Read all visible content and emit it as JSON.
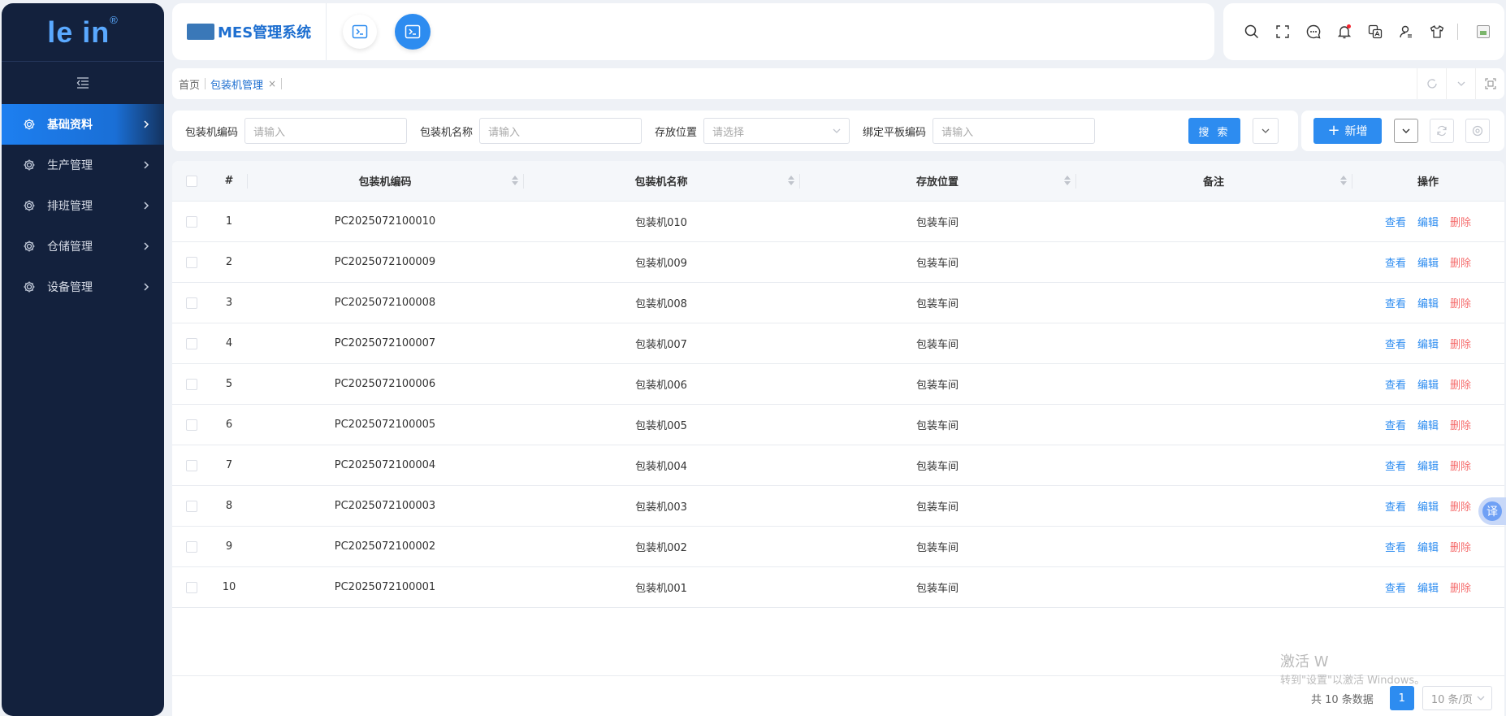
{
  "app": {
    "logo_text": "le  in",
    "logo_mark": "®",
    "system_name": "MES管理系统"
  },
  "sidebar": {
    "items": [
      {
        "label": "基础资料",
        "icon": "gear-icon",
        "active": true
      },
      {
        "label": "生产管理",
        "icon": "gear-icon",
        "active": false
      },
      {
        "label": "排班管理",
        "icon": "gear-icon",
        "active": false
      },
      {
        "label": "仓储管理",
        "icon": "gear-icon",
        "active": false
      },
      {
        "label": "设备管理",
        "icon": "gear-icon",
        "active": false
      }
    ]
  },
  "header": {
    "tools": [
      "search-icon",
      "fullscreen-icon",
      "chat-icon",
      "bell-icon",
      "translate-icon",
      "user-icon",
      "shirt-icon",
      "image-icon"
    ]
  },
  "breadcrumb": {
    "home": "首页",
    "active": "包装机管理",
    "close": "×"
  },
  "filters": {
    "code_label": "包装机编码",
    "code_placeholder": "请输入",
    "name_label": "包装机名称",
    "name_placeholder": "请输入",
    "location_label": "存放位置",
    "location_placeholder": "请选择",
    "tablet_label": "绑定平板编码",
    "tablet_placeholder": "请输入",
    "search_label": "搜 索"
  },
  "actions": {
    "add_label": "新增",
    "add_plus": "+"
  },
  "table": {
    "columns": {
      "idx": "#",
      "code": "包装机编码",
      "name": "包装机名称",
      "location": "存放位置",
      "note": "备注",
      "ops": "操作"
    },
    "op_labels": {
      "view": "查看",
      "edit": "编辑",
      "delete": "删除"
    },
    "rows": [
      {
        "idx": "1",
        "code": "PC2025072100010",
        "name": "包装机010",
        "location": "包装车间",
        "note": ""
      },
      {
        "idx": "2",
        "code": "PC2025072100009",
        "name": "包装机009",
        "location": "包装车间",
        "note": ""
      },
      {
        "idx": "3",
        "code": "PC2025072100008",
        "name": "包装机008",
        "location": "包装车间",
        "note": ""
      },
      {
        "idx": "4",
        "code": "PC2025072100007",
        "name": "包装机007",
        "location": "包装车间",
        "note": ""
      },
      {
        "idx": "5",
        "code": "PC2025072100006",
        "name": "包装机006",
        "location": "包装车间",
        "note": ""
      },
      {
        "idx": "6",
        "code": "PC2025072100005",
        "name": "包装机005",
        "location": "包装车间",
        "note": ""
      },
      {
        "idx": "7",
        "code": "PC2025072100004",
        "name": "包装机004",
        "location": "包装车间",
        "note": ""
      },
      {
        "idx": "8",
        "code": "PC2025072100003",
        "name": "包装机003",
        "location": "包装车间",
        "note": ""
      },
      {
        "idx": "9",
        "code": "PC2025072100002",
        "name": "包装机002",
        "location": "包装车间",
        "note": ""
      },
      {
        "idx": "10",
        "code": "PC2025072100001",
        "name": "包装机001",
        "location": "包装车间",
        "note": ""
      }
    ]
  },
  "pagination": {
    "total_text": "共 10 条数据",
    "current_page": "1",
    "page_size": "10 条/页"
  },
  "watermark": {
    "line1": "激活 W",
    "line2": "转到\"设置\"以激活 Windows。"
  },
  "float_translate": "译",
  "colors": {
    "primary": "#2d8cf0",
    "sidebar_bg": "#13213d",
    "danger": "#f56c6c"
  }
}
